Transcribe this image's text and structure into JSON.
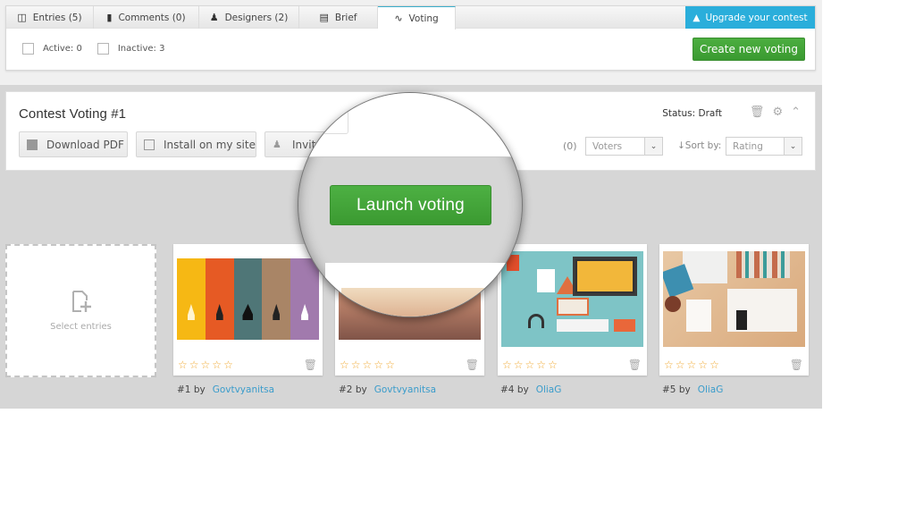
{
  "tabs": [
    {
      "label": "Entries (5)",
      "icon": "entries-icon",
      "active": false
    },
    {
      "label": "Comments (0)",
      "icon": "comments-icon",
      "active": false
    },
    {
      "label": "Designers (2)",
      "icon": "designers-icon",
      "active": false
    },
    {
      "label": "Brief",
      "icon": "book-icon",
      "active": false
    },
    {
      "label": "Voting",
      "icon": "chart-line-icon",
      "active": true
    }
  ],
  "upgrade": {
    "label": "Upgrade your contest",
    "icon": "upgrade-icon",
    "color": "#2aaedb"
  },
  "filters": {
    "active_label": "Active: 0",
    "inactive_label": "Inactive: 3"
  },
  "create_button": {
    "label": "Create new voting",
    "color": "#45a83a"
  },
  "voting": {
    "title": "Contest Voting #1",
    "status": "Status: Draft",
    "buttons": {
      "download_pdf": "Download PDF",
      "install": "Install on my site",
      "invite": "Invite"
    },
    "voters_count": "(0)",
    "voters_select": "Voters",
    "sort_label": "↓Sort by:",
    "sort_select": "Rating",
    "launch_button": "Launch voting"
  },
  "select_entries": {
    "label": "Select entries"
  },
  "entries": [
    {
      "number": "#1 by",
      "author": "Govtvyanitsa",
      "rating": 0,
      "max_rating": 5
    },
    {
      "number": "#2 by",
      "author": "Govtvyanitsa",
      "rating": 0,
      "max_rating": 5
    },
    {
      "number": "#4 by",
      "author": "OliaG",
      "rating": 0,
      "max_rating": 5
    },
    {
      "number": "#5 by",
      "author": "OliaG",
      "rating": 0,
      "max_rating": 5
    }
  ],
  "glyphs": {
    "star": "☆",
    "trash": "🗑",
    "caret": "⌄",
    "gear": "⚙",
    "chevron_up": "˄"
  }
}
